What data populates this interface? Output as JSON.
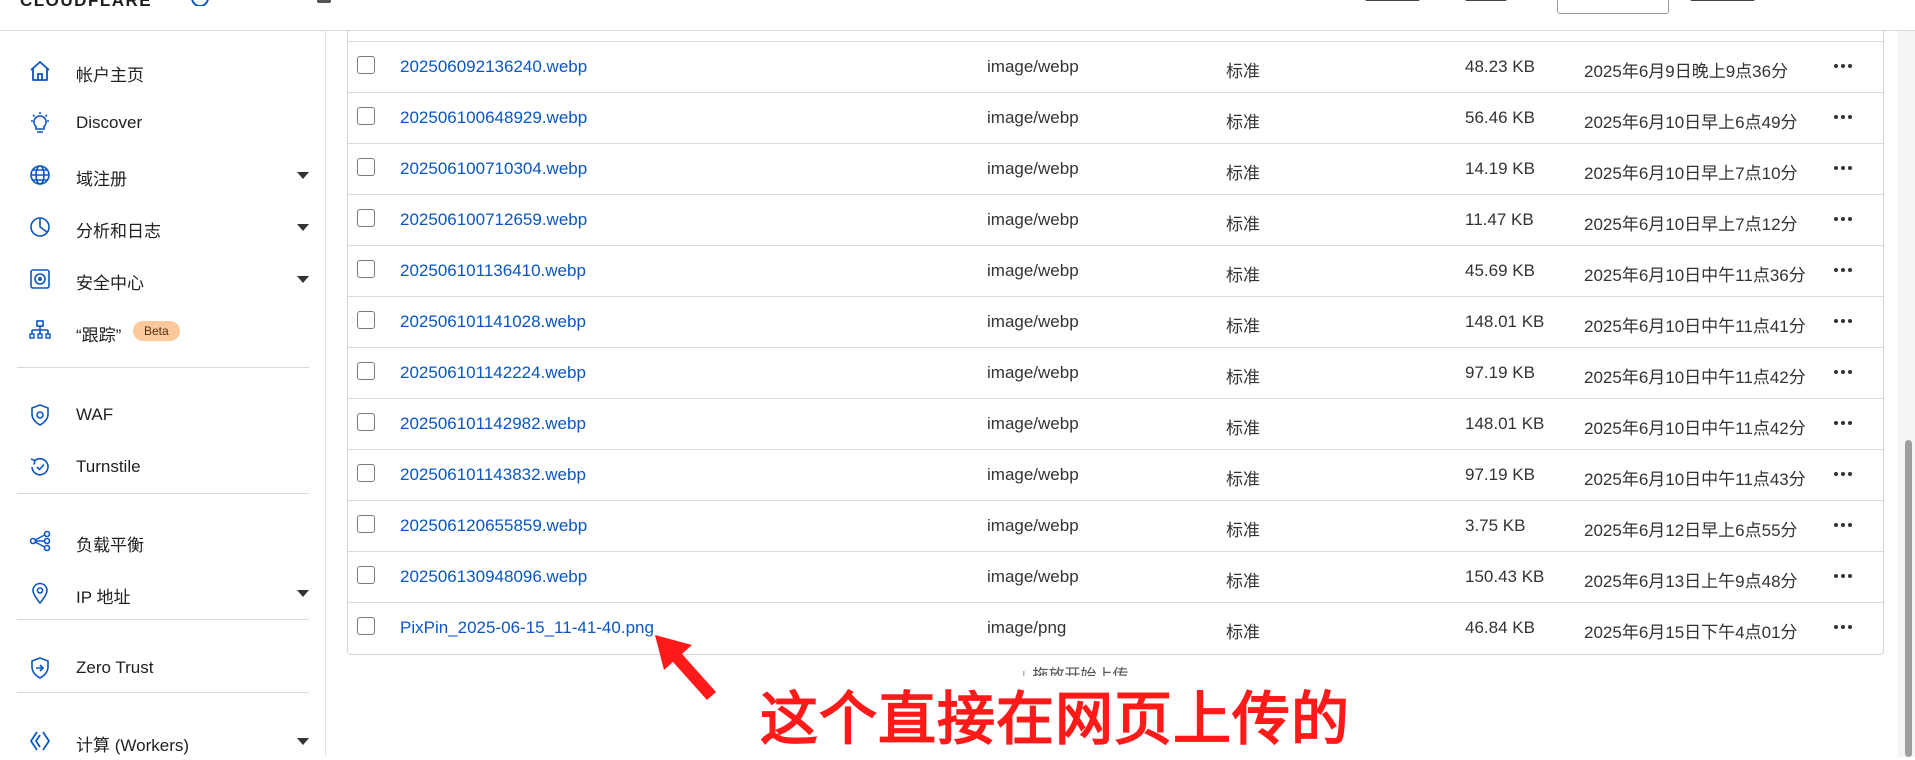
{
  "brand": {
    "logo_text": "CLOUDFLARE"
  },
  "sidebar": {
    "items": [
      {
        "label": "帐户主页",
        "icon": "home-icon",
        "caret": false
      },
      {
        "label": "Discover",
        "icon": "lightbulb-icon",
        "caret": false
      },
      {
        "label": "域注册",
        "icon": "globe-icon",
        "caret": true
      },
      {
        "label": "分析和日志",
        "icon": "pie-chart-icon",
        "caret": true
      },
      {
        "label": "安全中心",
        "icon": "security-center-icon",
        "caret": true
      },
      {
        "label": "“跟踪”",
        "icon": "trace-icon",
        "caret": false,
        "badge": "Beta"
      },
      {
        "label": "WAF",
        "icon": "waf-shield-icon",
        "caret": false
      },
      {
        "label": "Turnstile",
        "icon": "turnstile-icon",
        "caret": false
      },
      {
        "label": "负载平衡",
        "icon": "load-balancing-icon",
        "caret": false
      },
      {
        "label": "IP 地址",
        "icon": "location-pin-icon",
        "caret": true
      },
      {
        "label": "Zero Trust",
        "icon": "zero-trust-icon",
        "caret": false
      },
      {
        "label": "计算 (Workers)",
        "icon": "workers-icon",
        "caret": true
      }
    ]
  },
  "files": [
    {
      "name": "202506092136240.webp",
      "type": "image/webp",
      "class": "标准",
      "size": "48.23 KB",
      "date": "2025年6月9日晚上9点36分"
    },
    {
      "name": "202506100648929.webp",
      "type": "image/webp",
      "class": "标准",
      "size": "56.46 KB",
      "date": "2025年6月10日早上6点49分"
    },
    {
      "name": "202506100710304.webp",
      "type": "image/webp",
      "class": "标准",
      "size": "14.19 KB",
      "date": "2025年6月10日早上7点10分"
    },
    {
      "name": "202506100712659.webp",
      "type": "image/webp",
      "class": "标准",
      "size": "11.47 KB",
      "date": "2025年6月10日早上7点12分"
    },
    {
      "name": "202506101136410.webp",
      "type": "image/webp",
      "class": "标准",
      "size": "45.69 KB",
      "date": "2025年6月10日中午11点36分"
    },
    {
      "name": "202506101141028.webp",
      "type": "image/webp",
      "class": "标准",
      "size": "148.01 KB",
      "date": "2025年6月10日中午11点41分"
    },
    {
      "name": "202506101142224.webp",
      "type": "image/webp",
      "class": "标准",
      "size": "97.19 KB",
      "date": "2025年6月10日中午11点42分"
    },
    {
      "name": "202506101142982.webp",
      "type": "image/webp",
      "class": "标准",
      "size": "148.01 KB",
      "date": "2025年6月10日中午11点42分"
    },
    {
      "name": "202506101143832.webp",
      "type": "image/webp",
      "class": "标准",
      "size": "97.19 KB",
      "date": "2025年6月10日中午11点43分"
    },
    {
      "name": "202506120655859.webp",
      "type": "image/webp",
      "class": "标准",
      "size": "3.75 KB",
      "date": "2025年6月12日早上6点55分"
    },
    {
      "name": "202506130948096.webp",
      "type": "image/webp",
      "class": "标准",
      "size": "150.43 KB",
      "date": "2025年6月13日上午9点48分"
    },
    {
      "name": "PixPin_2025-06-15_11-41-40.png",
      "type": "image/png",
      "class": "标准",
      "size": "46.84 KB",
      "date": "2025年6月15日下午4点01分"
    }
  ],
  "bottom": {
    "partial_text": "↓ 拖放开始上传",
    "annotation": "这个直接在网页上传的"
  },
  "colors": {
    "link": "#0a56c2",
    "annotation": "#ff1a1a",
    "beta_badge": "#fbc99c"
  }
}
